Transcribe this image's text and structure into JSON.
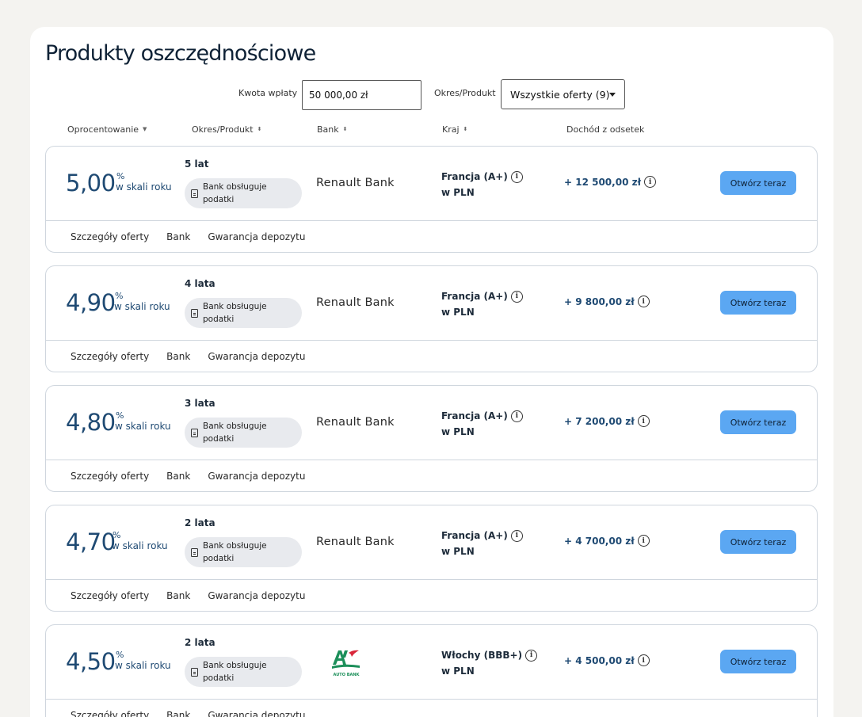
{
  "page": {
    "title": "Produkty oszczędnościowe"
  },
  "filters": {
    "amount_label": "Kwota wpłaty",
    "amount_value": "50 000,00 zł",
    "period_label": "Okres/Produkt",
    "period_select": "Wszystkie oferty (9)"
  },
  "columns": {
    "rate": "Oprocentowanie",
    "period": "Okres/Produkt",
    "bank": "Bank",
    "country": "Kraj",
    "income": "Dochód z odsetek"
  },
  "offers": [
    {
      "rate": "5,00",
      "pct": "%",
      "unit": "w skali roku",
      "period": "5 lat",
      "tax_line1": "Bank obsługuje",
      "tax_line2": "podatki",
      "bank": "Renault Bank",
      "country": "Francja (A+)",
      "currency": "w PLN",
      "income": "+ 12 500,00 zł",
      "cta": "Otwórz teraz",
      "tab_details": "Szczegóły oferty",
      "tab_bank": "Bank",
      "tab_guarantee": "Gwarancja depozytu"
    },
    {
      "rate": "4,90",
      "pct": "%",
      "unit": "w skali roku",
      "period": "4 lata",
      "tax_line1": "Bank obsługuje",
      "tax_line2": "podatki",
      "bank": "Renault Bank",
      "country": "Francja (A+)",
      "currency": "w PLN",
      "income": "+ 9 800,00 zł",
      "cta": "Otwórz teraz",
      "tab_details": "Szczegóły oferty",
      "tab_bank": "Bank",
      "tab_guarantee": "Gwarancja depozytu"
    },
    {
      "rate": "4,80",
      "pct": "%",
      "unit": "w skali roku",
      "period": "3 lata",
      "tax_line1": "Bank obsługuje",
      "tax_line2": "podatki",
      "bank": "Renault Bank",
      "country": "Francja (A+)",
      "currency": "w PLN",
      "income": "+ 7 200,00 zł",
      "cta": "Otwórz teraz",
      "tab_details": "Szczegóły oferty",
      "tab_bank": "Bank",
      "tab_guarantee": "Gwarancja depozytu"
    },
    {
      "rate": "4,70",
      "pct": "%",
      "unit": "w skali roku",
      "period": "2 lata",
      "tax_line1": "Bank obsługuje",
      "tax_line2": "podatki",
      "bank": "Renault Bank",
      "country": "Francja (A+)",
      "currency": "w PLN",
      "income": "+ 4 700,00 zł",
      "cta": "Otwórz teraz",
      "tab_details": "Szczegóły oferty",
      "tab_bank": "Bank",
      "tab_guarantee": "Gwarancja depozytu"
    },
    {
      "rate": "4,50",
      "pct": "%",
      "unit": "w skali roku",
      "period": "2 lata",
      "tax_line1": "Bank obsługuje",
      "tax_line2": "podatki",
      "bank_logo_text": "AUTO BANK",
      "country": "Włochy (BBB+)",
      "currency": "w PLN",
      "income": "+ 4 500,00 zł",
      "cta": "Otwórz teraz",
      "tab_details": "Szczegóły oferty",
      "tab_bank": "Bank",
      "tab_guarantee": "Gwarancja depozytu"
    }
  ],
  "colors": {
    "accent": "#5ba7f2",
    "rate_text": "#1f4a73",
    "logo_green": "#1c8f5a",
    "logo_red": "#d9263a"
  }
}
